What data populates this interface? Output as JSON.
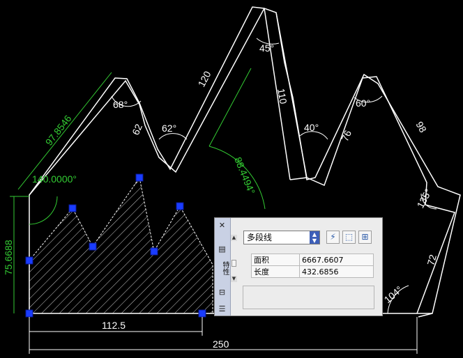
{
  "drawing": {
    "dimensions": {
      "d250": "250",
      "d112": "112.5",
      "d75": "75.6688",
      "d97": "97.8546",
      "d140": "140.0000°",
      "d884": "88.4494°",
      "d120": "120",
      "d110": "110",
      "d62": "62",
      "d76": "76",
      "d98": "98",
      "d72": "72",
      "a68": "68°",
      "a62": "62°",
      "a45": "45°",
      "a40": "40°",
      "a60": "60°",
      "a135": "135°",
      "a104": "104°"
    },
    "colors": {
      "outline": "#ffffff",
      "dimension_green": "#33cc33",
      "grip": "#1a3cff",
      "background": "#000000"
    }
  },
  "palette": {
    "title": "特性",
    "object_type": "多段线",
    "properties": [
      {
        "key": "面积",
        "value": "6667.6607"
      },
      {
        "key": "长度",
        "value": "432.6856"
      }
    ],
    "icons": {
      "close": "close-icon",
      "autohide": "autohide-icon",
      "menu": "menu-icon",
      "quickselect": "quick-select-icon",
      "selectobj": "select-objects-icon",
      "pickadd": "pickadd-icon"
    }
  }
}
